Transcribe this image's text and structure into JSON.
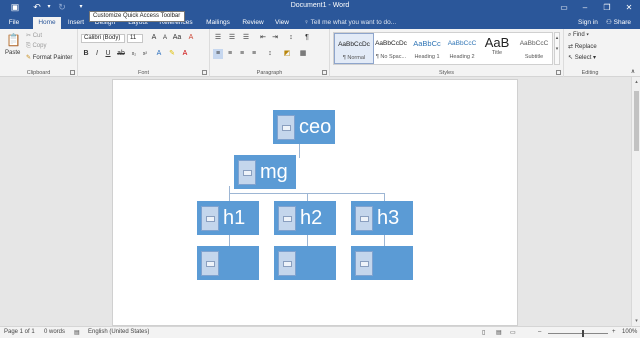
{
  "window": {
    "title": "Document1 - Word",
    "tooltip": "Customize Quick Access Toolbar"
  },
  "tabs": [
    {
      "label": "File"
    },
    {
      "label": "Home"
    },
    {
      "label": "Insert"
    },
    {
      "label": "Design"
    },
    {
      "label": "Layout"
    },
    {
      "label": "References"
    },
    {
      "label": "Mailings"
    },
    {
      "label": "Review"
    },
    {
      "label": "View"
    }
  ],
  "tell_me": "Tell me what you want to do...",
  "account": {
    "sign_in": "Sign in",
    "share": "Share"
  },
  "clipboard": {
    "paste": "Paste",
    "cut": "Cut",
    "copy": "Copy",
    "format_painter": "Format Painter",
    "label": "Clipboard"
  },
  "font": {
    "name": "Calibri (Body)",
    "size": "11",
    "label": "Font"
  },
  "paragraph": {
    "label": "Paragraph"
  },
  "styles": {
    "items": [
      {
        "preview": "AaBbCcDc",
        "name": "¶ Normal"
      },
      {
        "preview": "AaBbCcDc",
        "name": "¶ No Spac..."
      },
      {
        "preview": "AaBbCc",
        "name": "Heading 1"
      },
      {
        "preview": "AaBbCcC",
        "name": "Heading 2"
      },
      {
        "preview": "AaB",
        "name": "Title"
      },
      {
        "preview": "AaBbCcC",
        "name": "Subtitle"
      }
    ],
    "label": "Styles"
  },
  "editing": {
    "find": "Find",
    "replace": "Replace",
    "select": "Select",
    "label": "Editing"
  },
  "org_chart": {
    "ceo": "ceo",
    "mg": "mg",
    "h1": "h1",
    "h2": "h2",
    "h3": "h3"
  },
  "status": {
    "page": "Page 1 of 1",
    "words": "0 words",
    "language": "English (United States)",
    "zoom": "100%"
  },
  "colors": {
    "title_bar": "#2b579a",
    "node_fill": "#5b9bd5",
    "ribbon_bg": "#f3f3f3"
  }
}
